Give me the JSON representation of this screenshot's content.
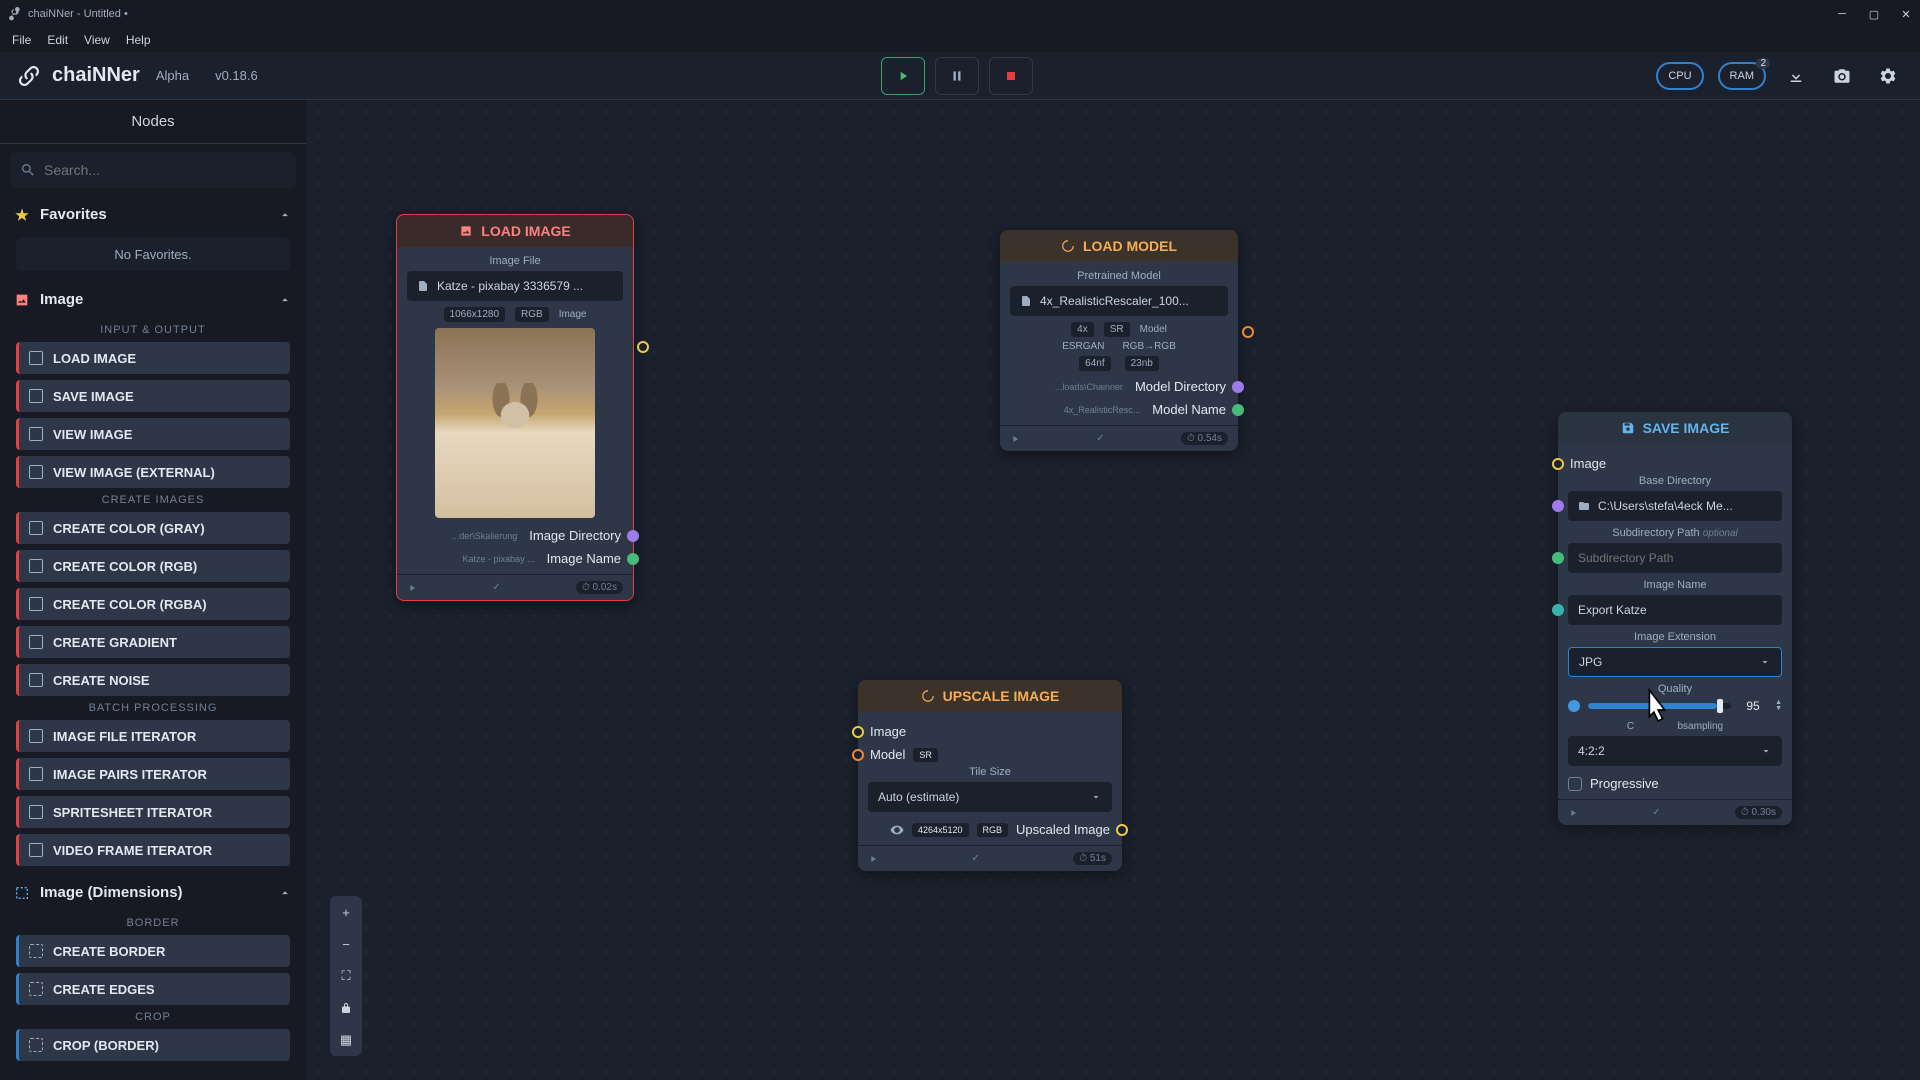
{
  "window": {
    "title": "chaiNNer - Untitled •"
  },
  "menu": {
    "file": "File",
    "edit": "Edit",
    "view": "View",
    "help": "Help"
  },
  "brand": {
    "name": "chaiNNer",
    "tag": "Alpha",
    "version": "v0.18.6"
  },
  "toolbar": {
    "cpu": "CPU",
    "ram": "RAM",
    "ram_badge": "2"
  },
  "sidebar": {
    "tab": "Nodes",
    "search_placeholder": "Search...",
    "favorites": {
      "title": "Favorites",
      "empty": "No Favorites."
    },
    "cat_image": "Image",
    "sub_io": "INPUT & OUTPUT",
    "sub_create": "CREATE IMAGES",
    "sub_batch": "BATCH PROCESSING",
    "cat_dims": "Image (Dimensions)",
    "sub_border": "BORDER",
    "sub_crop": "CROP",
    "items_io": [
      "LOAD IMAGE",
      "SAVE IMAGE",
      "VIEW IMAGE",
      "VIEW IMAGE (EXTERNAL)"
    ],
    "items_create": [
      "CREATE COLOR (GRAY)",
      "CREATE COLOR (RGB)",
      "CREATE COLOR (RGBA)",
      "CREATE GRADIENT",
      "CREATE NOISE"
    ],
    "items_batch": [
      "IMAGE FILE ITERATOR",
      "IMAGE PAIRS ITERATOR",
      "SPRITESHEET ITERATOR",
      "VIDEO FRAME ITERATOR"
    ],
    "items_border": [
      "CREATE BORDER",
      "CREATE EDGES"
    ],
    "items_crop": [
      "CROP (BORDER)"
    ]
  },
  "nodes": {
    "load_image": {
      "title": "LOAD IMAGE",
      "file_label": "Image File",
      "file_value": "Katze - pixabay 3336579 ...",
      "dims": "1066x1280",
      "fmt": "RGB",
      "type": "Image",
      "dir_tiny": "...der\\Skalierung",
      "dir_label": "Image Directory",
      "name_tiny": "Katze - pixabay ...",
      "name_label": "Image Name",
      "timer": "0.02s"
    },
    "load_model": {
      "title": "LOAD MODEL",
      "file_label": "Pretrained Model",
      "file_value": "4x_RealisticRescaler_100...",
      "scale": "4x",
      "sr": "SR",
      "type": "Model",
      "arch": "ESRGAN",
      "color": "RGB→RGB",
      "nf": "64nf",
      "nb": "23nb",
      "dir_tiny": "...loads\\Chainner",
      "dir_label": "Model Directory",
      "name_tiny": "4x_RealisticResc...",
      "name_label": "Model Name",
      "timer": "0.54s"
    },
    "upscale": {
      "title": "UPSCALE IMAGE",
      "in_image": "Image",
      "in_model": "Model",
      "sr": "SR",
      "tile_label": "Tile Size",
      "tile_value": "Auto (estimate)",
      "out_dims": "4264x5120",
      "out_fmt": "RGB",
      "out_label": "Upscaled Image",
      "timer": "51s"
    },
    "save_image": {
      "title": "SAVE IMAGE",
      "in_image": "Image",
      "basedir_label": "Base Directory",
      "basedir_value": "C:\\Users\\stefa\\4eck Me...",
      "subdir_label": "Subdirectory Path",
      "subdir_opt": "optional",
      "subdir_placeholder": "Subdirectory Path",
      "name_label": "Image Name",
      "name_value": "Export Katze",
      "ext_label": "Image Extension",
      "ext_value": "JPG",
      "quality_label": "Quality",
      "quality_value": "95",
      "chroma_label": "bsampling",
      "chroma_value": "4:2:2",
      "progressive": "Progressive",
      "timer": "0.30s"
    }
  }
}
